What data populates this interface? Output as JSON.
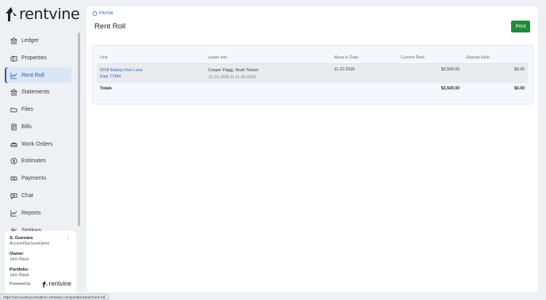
{
  "brand": {
    "name": "rentvine",
    "color": "#1d2126"
  },
  "sidebar": {
    "items": [
      {
        "label": "Ledger",
        "icon": "bank-icon"
      },
      {
        "label": "Properties",
        "icon": "buildings-icon"
      },
      {
        "label": "Rent Roll",
        "icon": "chart-icon",
        "active": true
      },
      {
        "label": "Statements",
        "icon": "bank-icon"
      },
      {
        "label": "Files",
        "icon": "folder-icon"
      },
      {
        "label": "Bills",
        "icon": "bill-icon"
      },
      {
        "label": "Work Orders",
        "icon": "toolbox-icon"
      },
      {
        "label": "Estimates",
        "icon": "dollar-icon"
      },
      {
        "label": "Payments",
        "icon": "money-icon"
      },
      {
        "label": "Chat",
        "icon": "chat-icon"
      },
      {
        "label": "Reports",
        "icon": "chart-icon"
      },
      {
        "label": "Settings",
        "icon": "settings-icon"
      }
    ],
    "accent": "#2c5fa8"
  },
  "user": {
    "name": "S. Guevara",
    "account": "AccountSuccessDemo",
    "owner_label": "Owner",
    "owner_value": "John Black",
    "portfolio_label": "Portfolio",
    "portfolio_value": "John Black",
    "powered_by": "Powered by",
    "powered_brand": "rentvine"
  },
  "breadcrumb": {
    "home": "Home"
  },
  "page": {
    "title": "Rent Roll",
    "print_label": "Print",
    "print_color": "#1f8a3b"
  },
  "table": {
    "headers": {
      "unit": "Unit",
      "lease_info": "Lease Info",
      "move_in": "Move in Date",
      "current_rent": "Current Rent",
      "deposit": "Deposit Held"
    },
    "rows": [
      {
        "unit_line1": "6018 Baileys Run Lane",
        "unit_line2": "Katy 77494",
        "tenants": "Cooper Flagg, Noah Tenant",
        "lease_dates": "11-21-2025 to 11-30-2026",
        "move_in": "11-22-2025",
        "current_rent": "$3,500.00",
        "deposit": "$0.00"
      }
    ],
    "totals": {
      "label": "Totals",
      "current_rent": "$3,500.00",
      "deposit": "$0.00"
    }
  },
  "status_bar": {
    "url": "https://accountsuccessdemo.rentvine.com/portals/owner/rent-roll"
  }
}
